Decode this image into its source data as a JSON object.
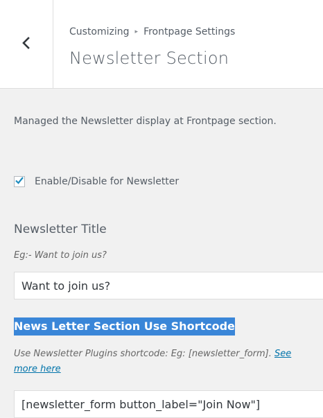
{
  "header": {
    "breadcrumb_parent": "Customizing",
    "breadcrumb_separator": "▸",
    "breadcrumb_current": "Frontpage Settings",
    "title": "Newsletter Section"
  },
  "section": {
    "description": "Managed the Newsletter display at Frontpage section.",
    "enable_checkbox": {
      "label": "Enable/Disable for Newsletter",
      "checked": true
    },
    "newsletter_title": {
      "label": "Newsletter Title",
      "hint": "Eg:- Want to join us?",
      "value": "Want to join us?"
    },
    "shortcode": {
      "label": "News Letter Section Use Shortcode",
      "hint_prefix": "Use Newsletter Plugins shortcode: Eg: [newsletter_form]. ",
      "hint_link": "See more here",
      "value": "[newsletter_form button_label=\"Join Now\"]"
    }
  },
  "icons": {
    "back": "chevron-left-icon",
    "check": "checkmark-icon"
  },
  "colors": {
    "panel_bg": "#f1f1f1",
    "header_bg": "#ffffff",
    "highlight_bg": "#3a86d8",
    "link": "#0073aa",
    "checkmark": "#1e8cbe"
  }
}
